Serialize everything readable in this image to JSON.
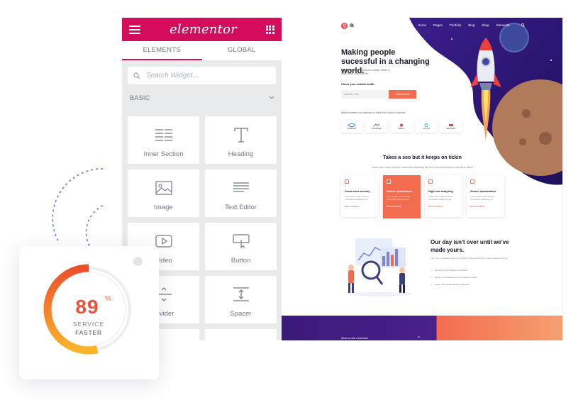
{
  "editor": {
    "logo": "elementor",
    "tabs": [
      {
        "label": "ELEMENTS",
        "active": true
      },
      {
        "label": "GLOBAL",
        "active": false
      }
    ],
    "search_placeholder": "Search Widget...",
    "category": "BASIC",
    "widgets": [
      {
        "label": "Inner Section",
        "icon": "inner-section-icon"
      },
      {
        "label": "Heading",
        "icon": "heading-icon"
      },
      {
        "label": "Image",
        "icon": "image-icon"
      },
      {
        "label": "Text Editor",
        "icon": "text-editor-icon"
      },
      {
        "label": "Video",
        "icon": "video-icon"
      },
      {
        "label": "Button",
        "icon": "button-icon"
      },
      {
        "label": "Divider",
        "icon": "divider-icon"
      },
      {
        "label": "Spacer",
        "icon": "spacer-icon"
      }
    ],
    "accent": "#d30c5c"
  },
  "preview": {
    "logo_text": "ik",
    "menu": [
      "Home",
      "Pages",
      "Portfolio",
      "Blog",
      "Shop",
      "Elements"
    ],
    "hero_title": "Making people sucessful in a changing world.",
    "hero_desc": "SEO Co a small business to create. Better a reasonable voice and its ...",
    "check_label": "Check your website traffic",
    "check_placeholder": "Website URL",
    "check_button": "Check Now",
    "brands_caption": "Market leaders use software to track their search business",
    "brands": [
      "COMPANY",
      "PowerStack",
      "MedCo",
      "COLOR",
      "DELIVERY"
    ],
    "section2_title": "Takes a seo but it keeps on tickin",
    "section2_sub": "Lorem ipsum dolor sit amet, consectetur adipiscing elit sed do eiusmod tempor incididunt ut labore",
    "cards": [
      {
        "title": "Great extra security",
        "desc": "Lorem ipsum dolor sit amet consectetur adipiscing elit",
        "more": "Discover More",
        "highlight": false
      },
      {
        "title": "Search optimization",
        "desc": "Lorem ipsum dolor sit amet consectetur adipiscing elit",
        "more": "Discover More",
        "highlight": true
      },
      {
        "title": "High-end analyzing",
        "desc": "Lorem ipsum dolor sit amet consectetur adipiscing elit",
        "more": "Discover More",
        "highlight": false
      },
      {
        "title": "Search optimization",
        "desc": "Lorem ipsum dolor sit amet consectetur adipiscing elit",
        "more": "Discover More",
        "highlight": false
      }
    ],
    "section3_title": "Our day isn't over until we've made yours.",
    "section3_desc": "Turn your marketing goals into full effect with everything a modern media planning ...",
    "checks": [
      "Benefit of your website conversion",
      "Boost your website ranking in search results",
      "Learn more about effective seo tools"
    ],
    "footer_text": "Work on site conversion",
    "footer_close": "×",
    "accent": "#f36c4f"
  },
  "stat": {
    "value": "89",
    "unit": "%",
    "label1": "SERVICE",
    "label2": "FASTER",
    "fraction": 0.89
  }
}
